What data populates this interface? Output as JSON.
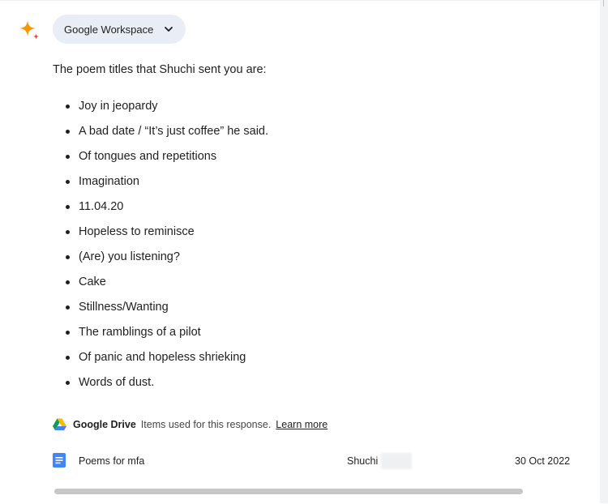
{
  "workspace_chip": {
    "label": "Google Workspace"
  },
  "response": {
    "intro": "The poem titles that Shuchi sent you are:",
    "titles": [
      "Joy in jeopardy",
      "A bad date / “It’s just coffee” he said.",
      "Of tongues and repetitions",
      "Imagination",
      "11.04.20",
      "Hopeless to reminisce",
      "(Are) you listening?",
      "Cake",
      "Stillness/Wanting",
      "The ramblings of a pilot",
      "Of panic and hopeless shrieking",
      "Words of dust."
    ]
  },
  "sources": {
    "app_name": "Google Drive",
    "note": "Items used for this response.",
    "learn_more": "Learn more"
  },
  "file": {
    "name": "Poems for mfa",
    "owner": "Shuchi",
    "date": "30 Oct 2022"
  },
  "icons": {
    "sparkle": "gemini-sparkle-icon",
    "chevron": "chevron-down-icon",
    "drive": "google-drive-icon",
    "doc": "google-docs-icon"
  },
  "colors": {
    "chip_bg": "#e9eef6",
    "docs_blue": "#4285f4",
    "sparkle_orange": "#f29900",
    "text": "#1f1f1f"
  }
}
